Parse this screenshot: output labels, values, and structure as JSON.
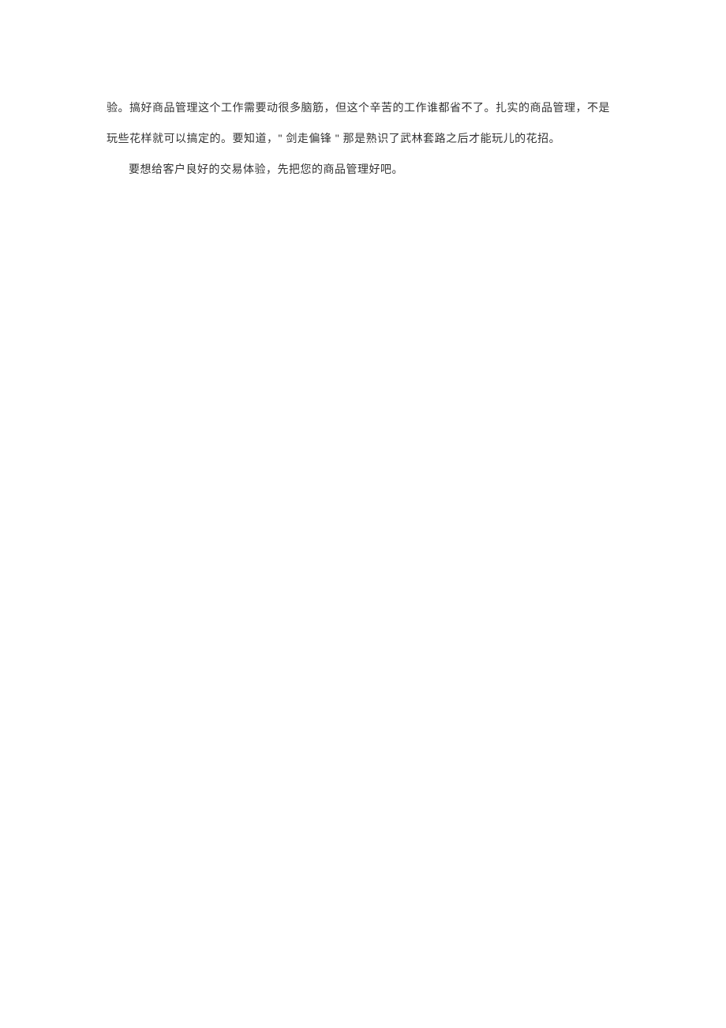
{
  "paragraphs": {
    "p1": "验。搞好商品管理这个工作需要动很多脑筋，但这个辛苦的工作谁都省不了。扎实的商品管理，不是玩些花样就可以搞定的。要知道，\" 剑走偏锋 \" 那是熟识了武林套路之后才能玩儿的花招。",
    "p2": "要想给客户良好的交易体验，先把您的商品管理好吧。"
  }
}
